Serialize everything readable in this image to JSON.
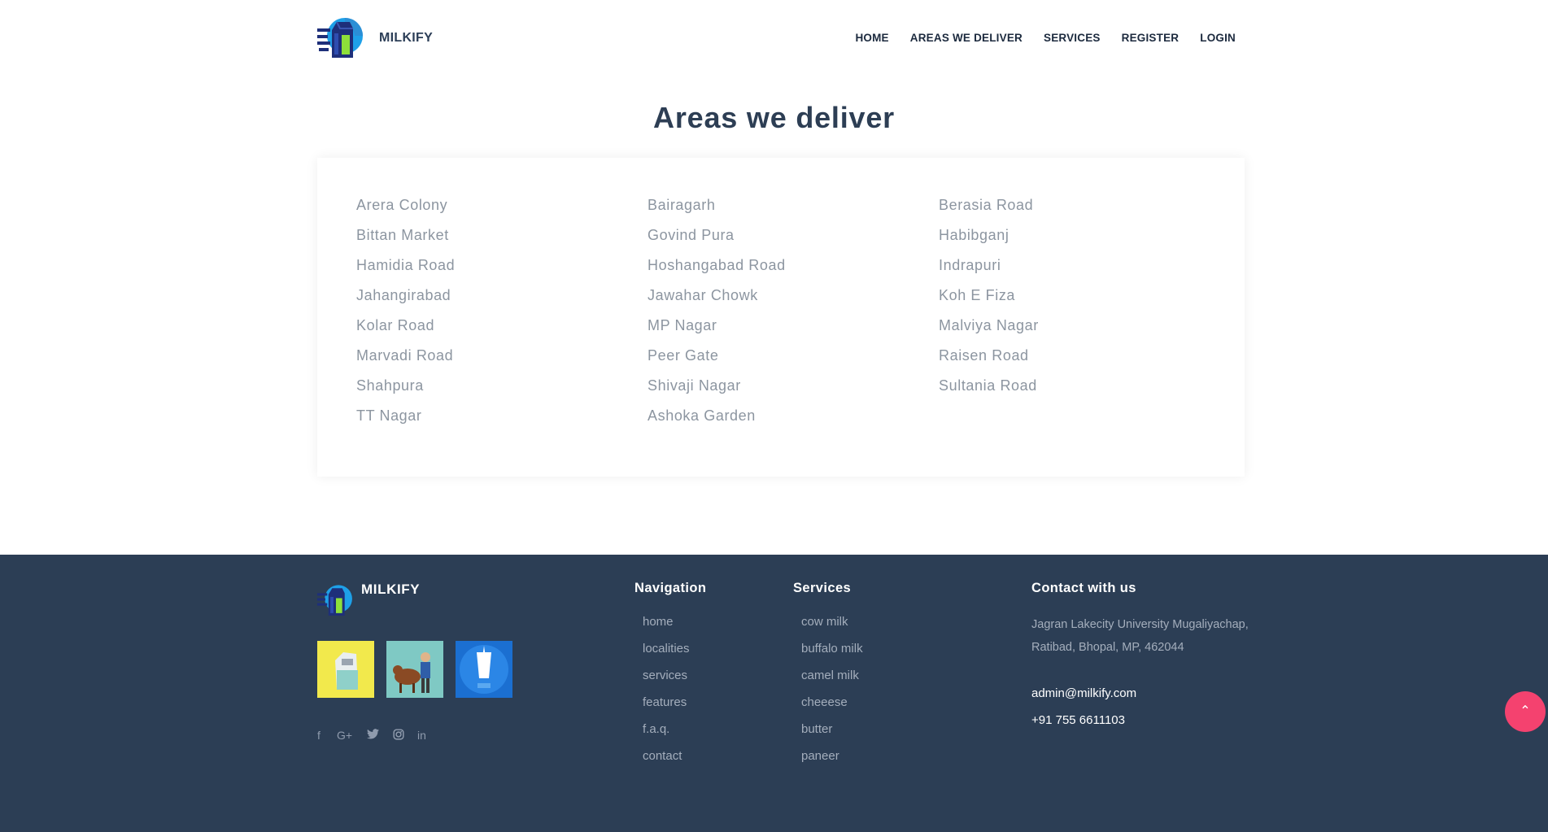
{
  "header": {
    "brand": "MILKIFY",
    "logo_icon": "milk-carton-logo-icon",
    "nav": [
      {
        "label": "HOME"
      },
      {
        "label": "AREAS WE DELIVER"
      },
      {
        "label": "SERVICES"
      },
      {
        "label": "REGISTER"
      },
      {
        "label": "LOGIN"
      }
    ]
  },
  "areas": {
    "title": "Areas we deliver",
    "items": [
      "Arera Colony",
      "Bairagarh",
      "Berasia Road",
      "Bittan Market",
      "Govind Pura",
      "Habibganj",
      "Hamidia Road",
      "Hoshangabad Road",
      "Indrapuri",
      "Jahangirabad",
      "Jawahar Chowk",
      "Koh E Fiza",
      "Kolar Road",
      "MP Nagar",
      "Malviya Nagar",
      "Marvadi Road",
      "Peer Gate",
      "Raisen Road",
      "Shahpura",
      "Shivaji Nagar",
      "Sultania Road",
      "TT Nagar",
      "Ashoka Garden"
    ]
  },
  "footer": {
    "brand": "MILKIFY",
    "thumbnails": [
      {
        "icon": "milk-carton-image"
      },
      {
        "icon": "cow-farmer-image"
      },
      {
        "icon": "milk-glass-image"
      }
    ],
    "social": [
      "facebook-icon",
      "google-plus-icon",
      "twitter-icon",
      "instagram-icon",
      "linkedin-icon"
    ],
    "navigation": {
      "heading": "Navigation",
      "items": [
        "home",
        "localities",
        "services",
        "features",
        "f.a.q.",
        "contact"
      ]
    },
    "services": {
      "heading": "Services",
      "items": [
        "cow milk",
        "buffalo milk",
        "camel milk",
        "cheeese",
        "butter",
        "paneer"
      ]
    },
    "contact": {
      "heading": "Contact with us",
      "address": "Jagran Lakecity University Mugaliyachap, Ratibad, Bhopal, MP, 462044",
      "email": "admin@milkify.com",
      "phone": "+91 755 6611103"
    }
  },
  "colors": {
    "footer_bg": "#2c3e55",
    "title_text": "#2d3e54",
    "area_text": "#8c95a0",
    "scroll_top_button": "#f4426f"
  }
}
